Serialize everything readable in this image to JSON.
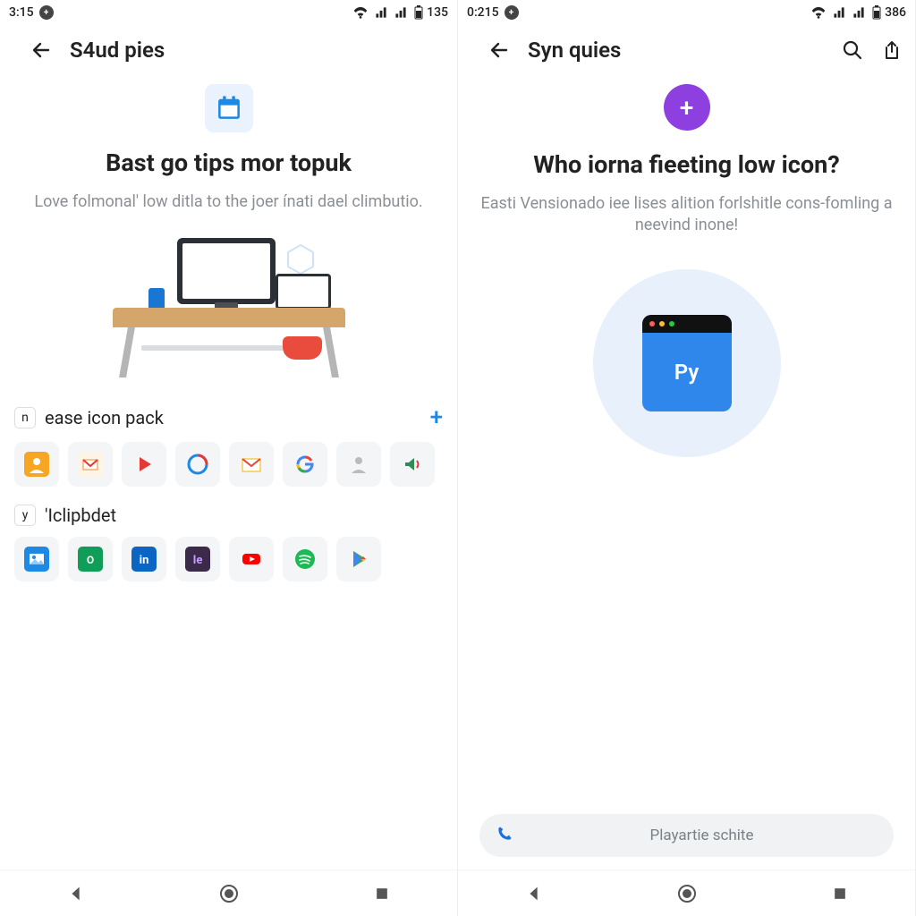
{
  "left": {
    "status": {
      "time": "3:15",
      "battery": "135"
    },
    "appbar": {
      "title": "S4ud pies"
    },
    "hero": {
      "title": "Bast go tips mor topuk",
      "subtitle": "Love folmonal' low ditla to the joer ínati dael climbutio."
    },
    "sections": [
      {
        "id": "ease",
        "tag": "n",
        "label": "ease icon pack",
        "icons": [
          "contact",
          "mail",
          "play",
          "browser",
          "gmail",
          "google",
          "person",
          "speaker"
        ]
      },
      {
        "id": "clip",
        "tag": "y",
        "label": "'Iclipbdet",
        "icons": [
          "image",
          "sheets",
          "linkedin",
          "adobe",
          "youtube",
          "spotify",
          "playstore"
        ]
      }
    ]
  },
  "right": {
    "status": {
      "time": "0:215",
      "battery": "386"
    },
    "appbar": {
      "title": "Syn quies"
    },
    "hero": {
      "title": "Who iorna fieeting low icon?",
      "subtitle": "Easti Vensionado iee lises alition forlshitle cons-fomling a neevind inone!",
      "card_label": "Py"
    },
    "search": {
      "placeholder": "Playartie schite"
    }
  },
  "colors": {
    "accent_blue": "#1e88e5",
    "accent_purple": "#8d3fe0",
    "card_blue": "#2f86eb",
    "muted": "#8a8f95"
  },
  "glyphs": {
    "plus": "+"
  }
}
